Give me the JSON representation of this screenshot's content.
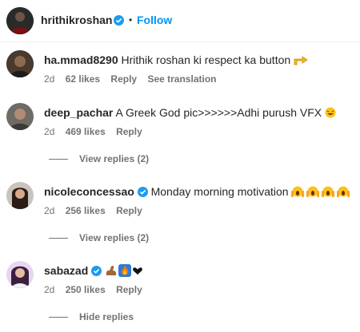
{
  "header": {
    "username": "hrithikroshan",
    "separator": "•",
    "follow_label": "Follow"
  },
  "comments": [
    {
      "username": "ha.mmad8290",
      "text": "Hrithik roshan ki respect ka button",
      "emoji": "pointing-hand-icon",
      "age": "2d",
      "likes": "62 likes",
      "reply_label": "Reply",
      "translate_label": "See translation",
      "replies_label": ""
    },
    {
      "username": "deep_pachar",
      "text": "A Greek God pic>>>>>>Adhi purush VFX",
      "emoji": "laughing-face-icon",
      "age": "2d",
      "likes": "469 likes",
      "reply_label": "Reply",
      "replies_label": "View replies (2)"
    },
    {
      "username": "nicoleconcessao",
      "verified": true,
      "text": "Monday morning motivation",
      "emoji": "screaming-face-icon",
      "age": "2d",
      "likes": "256 likes",
      "reply_label": "Reply",
      "replies_label": "View replies (2)"
    },
    {
      "username": "sabazad",
      "verified": true,
      "text": "",
      "emoji": "flexed-biceps-fire-heart-icons",
      "age": "2d",
      "likes": "250 likes",
      "reply_label": "Reply",
      "replies_label": "Hide replies"
    }
  ],
  "colors": {
    "link_blue": "#0095f6",
    "verified_blue": "#1d9bf0",
    "meta_gray": "#737373"
  }
}
